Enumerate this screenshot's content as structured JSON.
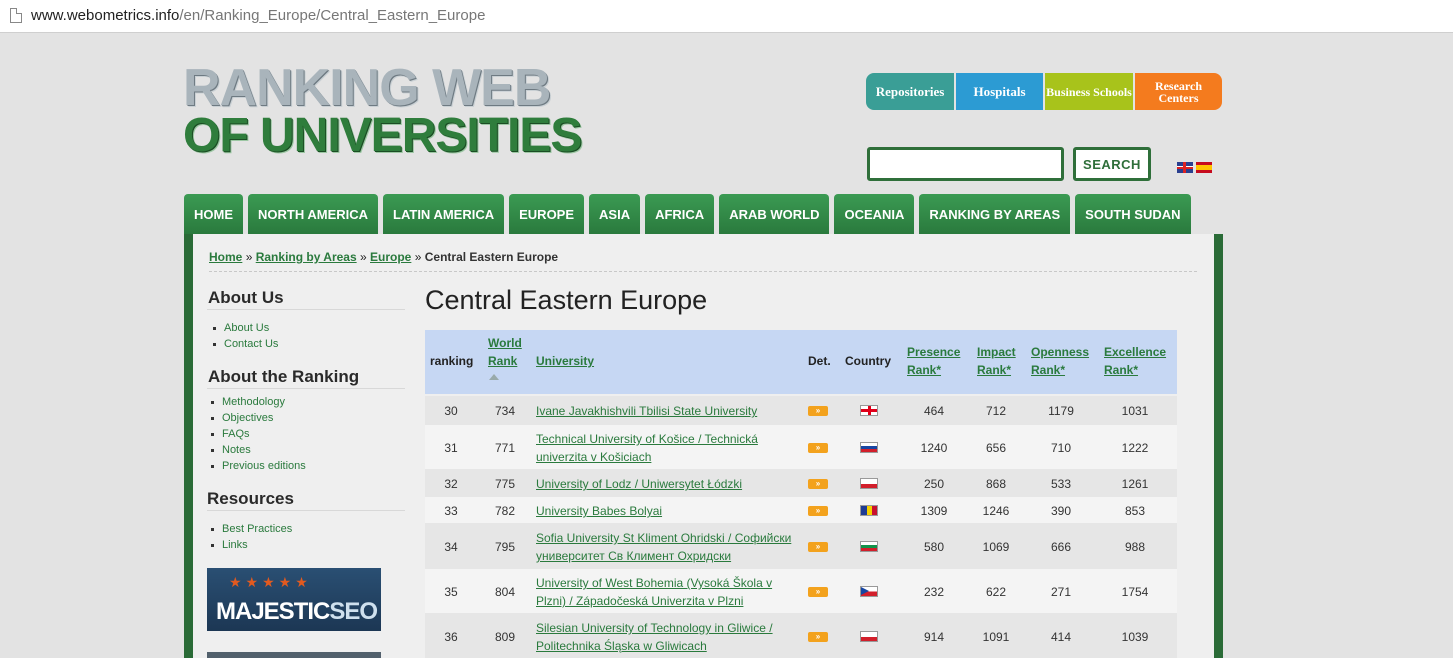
{
  "browser": {
    "url_domain": "www.webometrics.info",
    "url_path": "/en/Ranking_Europe/Central_Eastern_Europe"
  },
  "logo": {
    "line1": "RANKING WEB",
    "line2": "OF UNIVERSITIES"
  },
  "top_buttons": {
    "repositories": "Repositories",
    "hospitals": "Hospitals",
    "business_schools": "Business Schools",
    "research_centers": "Research Centers"
  },
  "search": {
    "value": "",
    "button": "SEARCH"
  },
  "nav": [
    "HOME",
    "NORTH AMERICA",
    "LATIN AMERICA",
    "EUROPE",
    "ASIA",
    "AFRICA",
    "ARAB WORLD",
    "OCEANIA",
    "RANKING BY AREAS",
    "SOUTH SUDAN"
  ],
  "breadcrumb": {
    "home": "Home",
    "areas": "Ranking by Areas",
    "europe": "Europe",
    "sep": "»",
    "current": "Central Eastern Europe"
  },
  "sidebar": {
    "about_us": {
      "title": "About Us",
      "items": [
        "About Us",
        "Contact Us"
      ]
    },
    "about_ranking": {
      "title": "About the Ranking",
      "items": [
        "Methodology",
        "Objectives",
        "FAQs",
        "Notes",
        "Previous editions"
      ]
    },
    "resources": {
      "title": "Resources",
      "items": [
        "Best Practices",
        "Links"
      ]
    },
    "ad": {
      "majestic": "MAJESTIC",
      "seo": "SEO"
    }
  },
  "page_title": "Central Eastern Europe",
  "table": {
    "headers": {
      "ranking": "ranking",
      "world_rank_1": "World",
      "world_rank_2": "Rank",
      "university": "University",
      "det": "Det.",
      "country": "Country",
      "presence_1": "Presence",
      "presence_2": "Rank*",
      "impact_1": "Impact",
      "impact_2": "Rank*",
      "openness_1": "Openness",
      "openness_2": "Rank*",
      "excellence_1": "Excellence",
      "excellence_2": "Rank*"
    },
    "det_glyph": "»",
    "rows": [
      {
        "ranking": "30",
        "world": "734",
        "university": "Ivane Javakhishvili Tbilisi State University",
        "country_flag": "ge",
        "presence": "464",
        "impact": "712",
        "openness": "1179",
        "excellence": "1031"
      },
      {
        "ranking": "31",
        "world": "771",
        "university": "Technical University of Košice / Technická univerzita v Košiciach",
        "country_flag": "sk",
        "presence": "1240",
        "impact": "656",
        "openness": "710",
        "excellence": "1222"
      },
      {
        "ranking": "32",
        "world": "775",
        "university": "University of Lodz / Uniwersytet Łódzki",
        "country_flag": "pl",
        "presence": "250",
        "impact": "868",
        "openness": "533",
        "excellence": "1261"
      },
      {
        "ranking": "33",
        "world": "782",
        "university": "University Babes Bolyai",
        "country_flag": "ro",
        "presence": "1309",
        "impact": "1246",
        "openness": "390",
        "excellence": "853"
      },
      {
        "ranking": "34",
        "world": "795",
        "university": "Sofia University St Kliment Ohridski / Софийски университет Св Климент Охридски",
        "country_flag": "bg",
        "presence": "580",
        "impact": "1069",
        "openness": "666",
        "excellence": "988"
      },
      {
        "ranking": "35",
        "world": "804",
        "university": "University of West Bohemia (Vysoká Škola v Plzni) / Západočeská Univerzita v Plzni",
        "country_flag": "cz",
        "presence": "232",
        "impact": "622",
        "openness": "271",
        "excellence": "1754"
      },
      {
        "ranking": "36",
        "world": "809",
        "university": "Silesian University of Technology in Gliwice / Politechnika Śląska w Gliwicach",
        "country_flag": "pl",
        "presence": "914",
        "impact": "1091",
        "openness": "414",
        "excellence": "1039"
      }
    ]
  }
}
